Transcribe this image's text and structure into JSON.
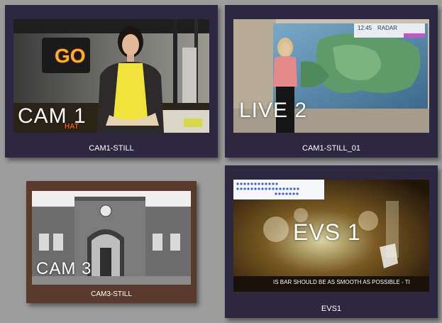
{
  "colors": {
    "background": "#9d9d9d",
    "tile_bg": "#2d2840",
    "tile_bg_brown": "#5a3a2c",
    "label": "#ffffff"
  },
  "tiles": [
    {
      "label": "CAM1-STILL",
      "overlay": "CAM 1",
      "logo": "GO",
      "lower_third": "HAT"
    },
    {
      "label": "CAM1-STILL_01",
      "overlay": "LIVE 2",
      "weather_time": "12:45",
      "weather_brand": "RADAR"
    },
    {
      "label": "CAM3-STILL",
      "overlay": "CAM 3"
    },
    {
      "label": "EVS1",
      "overlay": "EVS 1",
      "ticker": "IS BAR SHOULD BE AS SMOOTH AS POSSIBLE - TI"
    }
  ]
}
